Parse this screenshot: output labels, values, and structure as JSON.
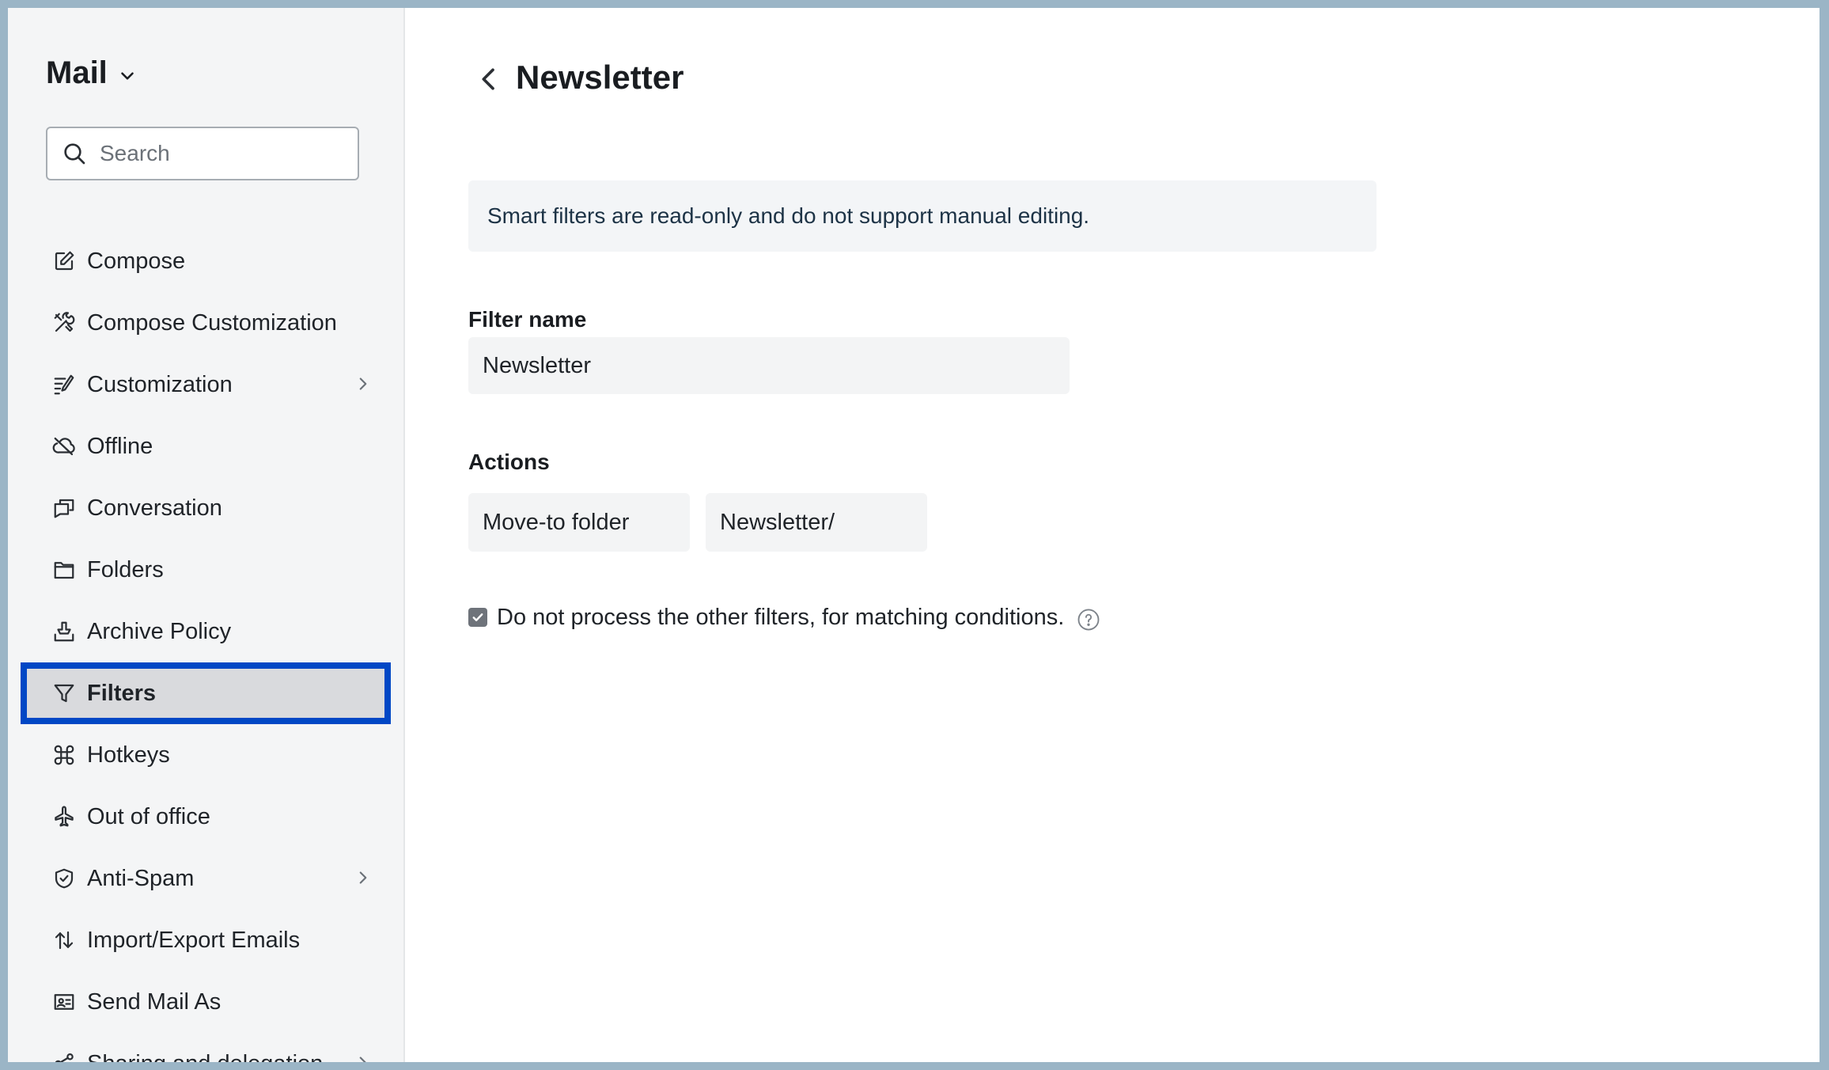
{
  "sidebar": {
    "app_title": "Mail",
    "search": {
      "placeholder": "Search",
      "value": ""
    },
    "items": [
      {
        "label": "Compose",
        "icon": "compose-icon"
      },
      {
        "label": "Compose Customization",
        "icon": "tools-icon"
      },
      {
        "label": "Customization",
        "icon": "customize-icon",
        "has_submenu": true
      },
      {
        "label": "Offline",
        "icon": "cloud-off-icon"
      },
      {
        "label": "Conversation",
        "icon": "conversation-icon"
      },
      {
        "label": "Folders",
        "icon": "folder-icon"
      },
      {
        "label": "Archive Policy",
        "icon": "archive-icon"
      },
      {
        "label": "Filters",
        "icon": "filter-icon",
        "active": true
      },
      {
        "label": "Hotkeys",
        "icon": "command-icon"
      },
      {
        "label": "Out of office",
        "icon": "airplane-icon"
      },
      {
        "label": "Anti-Spam",
        "icon": "shield-icon",
        "has_submenu": true
      },
      {
        "label": "Import/Export Emails",
        "icon": "import-export-icon"
      },
      {
        "label": "Send Mail As",
        "icon": "id-card-icon"
      },
      {
        "label": "Sharing and delegation",
        "icon": "share-icon",
        "has_submenu": true
      }
    ]
  },
  "main": {
    "title": "Newsletter",
    "info_banner": "Smart filters are read-only and do not support manual editing.",
    "filter_name_label": "Filter name",
    "filter_name_value": "Newsletter",
    "actions_label": "Actions",
    "action_type": "Move-to folder",
    "action_target": "Newsletter/",
    "checkbox_label": "Do not process the other filters, for matching conditions.",
    "checkbox_checked": true
  },
  "colors": {
    "active_outline": "#0047c5",
    "sidebar_bg": "#f4f5f6",
    "active_bg": "#d9dadd"
  }
}
